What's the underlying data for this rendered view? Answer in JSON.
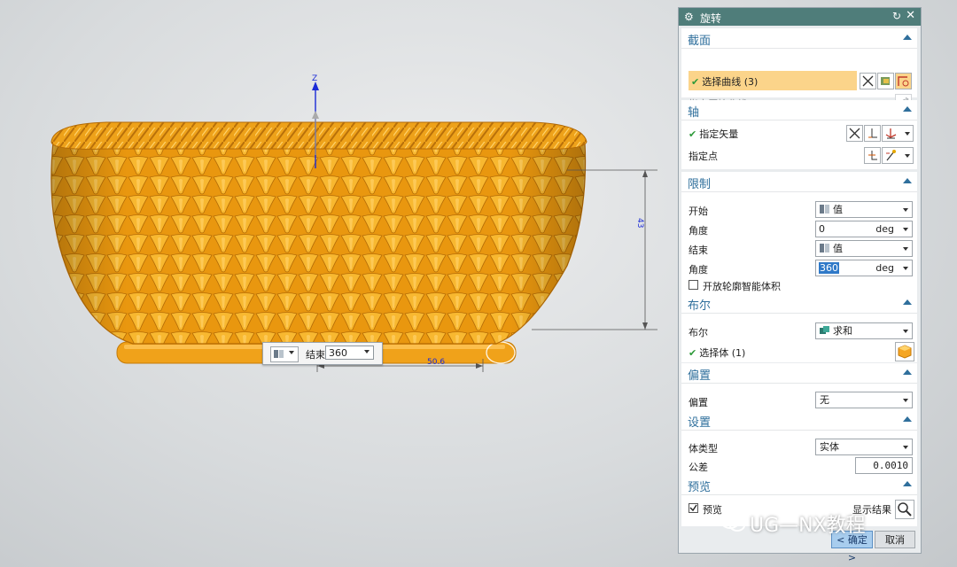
{
  "dialog": {
    "title": "旋转",
    "sections": {
      "section": {
        "header": "截面",
        "select_curve_label": "选择曲线 (3)",
        "specify_origin_curve_label": "指定原始曲线"
      },
      "axis": {
        "header": "轴",
        "specify_vector_label": "指定矢量",
        "specify_point_label": "指定点"
      },
      "limits": {
        "header": "限制",
        "start_label": "开始",
        "start_type": "值",
        "start_angle_label": "角度",
        "start_angle_value": "0",
        "start_angle_unit": "deg",
        "end_label": "结束",
        "end_type": "值",
        "end_angle_label": "角度",
        "end_angle_value": "360",
        "end_angle_unit": "deg",
        "open_profile_label": "开放轮廓智能体积",
        "open_profile_checked": false
      },
      "boolean": {
        "header": "布尔",
        "boolean_label": "布尔",
        "boolean_value": "求和",
        "select_body_label": "选择体 (1)"
      },
      "offset": {
        "header": "偏置",
        "offset_label": "偏置",
        "offset_value": "无"
      },
      "settings": {
        "header": "设置",
        "body_type_label": "体类型",
        "body_type_value": "实体",
        "tolerance_label": "公差",
        "tolerance_value": "0.0010"
      },
      "preview": {
        "header": "预览",
        "preview_label": "预览",
        "preview_checked": true,
        "show_result_label": "显示结果"
      }
    },
    "ok_label": "< 确定 >",
    "cancel_label": "取消"
  },
  "viewport": {
    "axis_label": "Z",
    "dimension_vertical": "43",
    "dimension_horizontal": "50.6",
    "float_bar": {
      "end_label": "结束",
      "end_value": "360"
    }
  },
  "watermark": "UG—NX教程",
  "colors": {
    "basket": "#f2a81d",
    "basket_dark": "#c77a07",
    "title_bar": "#4f7d7a",
    "section_header": "#2f6f9c",
    "selected_row": "#fbd48a",
    "dimension": "#1b2bd6"
  }
}
